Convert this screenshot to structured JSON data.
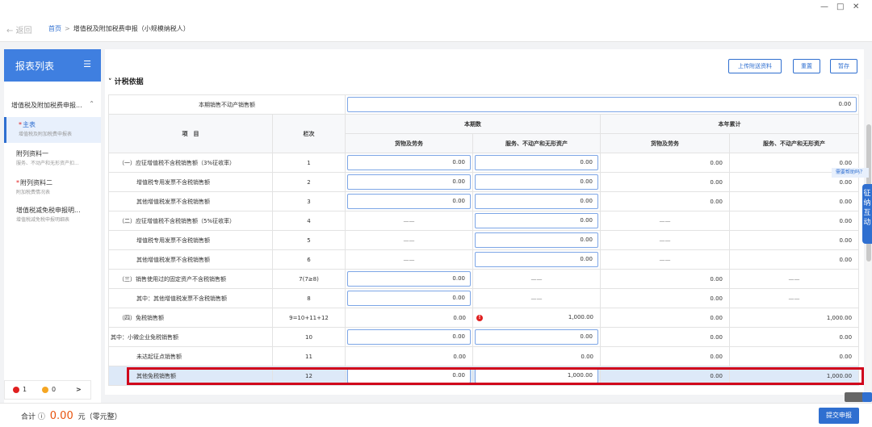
{
  "window": {
    "minimize": "—",
    "maximize": "□",
    "close": "✕"
  },
  "nav": {
    "back": "← 返回",
    "home": "首页",
    "sep": ">",
    "current": "增值税及附加税费申报（小规模纳税人）"
  },
  "sidebar": {
    "title": "报表列表",
    "group": "增值税及附加税费申报...",
    "items": [
      {
        "title": "主表",
        "sub": "增值税及附加税费申报表",
        "required": true,
        "active": true
      },
      {
        "title": "附列资料一",
        "sub": "服务、不动产和无形资产扣...",
        "required": false
      },
      {
        "title": "附列资料二",
        "sub": "附加税费情况表",
        "required": true
      },
      {
        "title": "增值税减免税申报明...",
        "sub": "增值税减免税申报明细表",
        "required": false
      }
    ],
    "errors": {
      "red_count": "1",
      "orange_count": "0",
      "arrow": ">"
    }
  },
  "toolbar": {
    "upload": "上传附送资料",
    "reset": "重置",
    "save": "暂存"
  },
  "section_title": "计税依据",
  "table": {
    "row0_label": "本期销售不动产销售额",
    "row0_value": "0.00",
    "h_item": "项　目",
    "h_col": "栏次",
    "h_current": "本期数",
    "h_ytd": "本年累计",
    "h_goods": "货物及劳务",
    "h_services": "服务、不动产和无形资产",
    "h_goods2": "货物及劳务",
    "h_services2": "服务、不动产和无形资产",
    "rows": [
      {
        "label": "（一）应征增值税不含税销售额（3%征收率）",
        "col": "1",
        "v": [
          "0.00",
          "0.00",
          "0.00",
          "0.00"
        ]
      },
      {
        "label": "增值税专用发票不含税销售额",
        "col": "2",
        "v": [
          "0.00",
          "0.00",
          "0.00",
          "0.00"
        ]
      },
      {
        "label": "其他增值税发票不含税销售额",
        "col": "3",
        "v": [
          "0.00",
          "0.00",
          "0.00",
          "0.00"
        ]
      },
      {
        "label": "（二）应征增值税不含税销售额（5%征收率）",
        "col": "4",
        "v": [
          "——",
          "0.00",
          "——",
          "0.00"
        ]
      },
      {
        "label": "增值税专用发票不含税销售额",
        "col": "5",
        "v": [
          "——",
          "0.00",
          "——",
          "0.00"
        ]
      },
      {
        "label": "其他增值税发票不含税销售额",
        "col": "6",
        "v": [
          "——",
          "0.00",
          "——",
          "0.00"
        ]
      },
      {
        "label": "（三）销售使用过的固定资产不含税销售额",
        "col": "7(7≥8)",
        "v": [
          "0.00",
          "——",
          "0.00",
          "——"
        ]
      },
      {
        "label": "其中：其他增值税发票不含税销售额",
        "col": "8",
        "v": [
          "0.00",
          "——",
          "0.00",
          "——"
        ]
      },
      {
        "label": "（四）免税销售额",
        "col": "9=10+11+12",
        "v": [
          "0.00",
          "1,000.00",
          "0.00",
          "1,000.00"
        ]
      },
      {
        "label": "其中：小微企业免税销售额",
        "col": "10",
        "v": [
          "0.00",
          "0.00",
          "0.00",
          "0.00"
        ]
      },
      {
        "label": "未达起征点销售额",
        "col": "11",
        "v": [
          "0.00",
          "0.00",
          "0.00",
          "0.00"
        ]
      },
      {
        "label": "其他免税销售额",
        "col": "12",
        "v": [
          "0.00",
          "1,000.00",
          "0.00",
          "1,000.00"
        ]
      }
    ]
  },
  "footer": {
    "total_label": "合计",
    "info_icon": "ⓘ",
    "total_amount": "0.00",
    "unit": "元（零元整）",
    "submit": "提交申报"
  },
  "float": {
    "help": "需要帮助吗？",
    "tab": "征纳互动"
  }
}
